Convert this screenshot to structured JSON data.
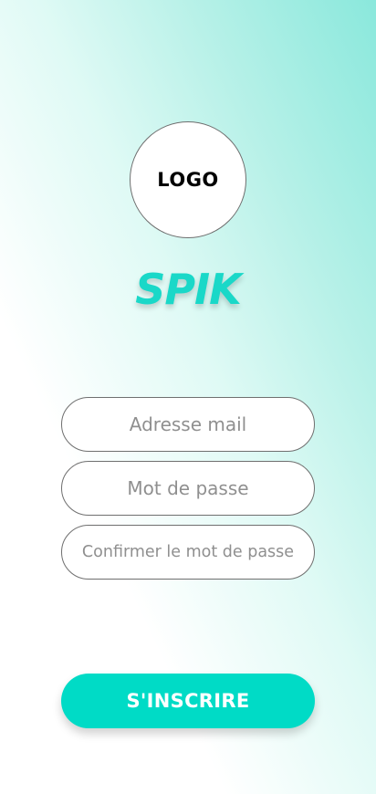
{
  "colors": {
    "accent": "#00dbc6",
    "title": "#1ad8c8",
    "field_border": "#6f6f6f",
    "placeholder": "#8f8f8f",
    "background_gradient": [
      "#ffffff",
      "#8ae8dc"
    ]
  },
  "logo": {
    "text": "LOGO"
  },
  "app": {
    "title": "SPIK"
  },
  "form": {
    "email": {
      "placeholder": "Adresse mail",
      "value": ""
    },
    "password": {
      "placeholder": "Mot de passe",
      "value": ""
    },
    "confirm_password": {
      "placeholder": "Confirmer le mot de passe",
      "value": ""
    }
  },
  "actions": {
    "signup_label": "S'INSCRIRE"
  }
}
